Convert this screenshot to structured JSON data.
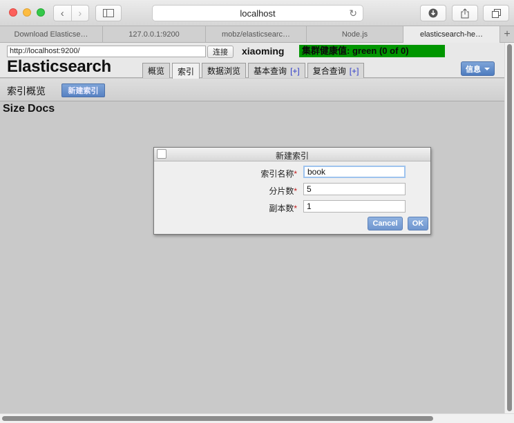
{
  "browser": {
    "url": "localhost",
    "tabs": [
      {
        "label": "Download Elasticse…",
        "active": false
      },
      {
        "label": "127.0.0.1:9200",
        "active": false
      },
      {
        "label": "mobz/elasticsearc…",
        "active": false
      },
      {
        "label": "Node.js",
        "active": false
      },
      {
        "label": "elasticsearch-he…",
        "active": true
      }
    ],
    "new_tab_label": "+"
  },
  "header": {
    "cluster_url": "http://localhost:9200/",
    "connect_label": "连接",
    "cluster_name": "xiaoming",
    "health": "集群健康值: green (0 of 0)",
    "brand": "Elasticsearch",
    "tabs": [
      {
        "label": "概览",
        "plus": ""
      },
      {
        "label": "索引",
        "plus": ""
      },
      {
        "label": "数据浏览",
        "plus": ""
      },
      {
        "label": "基本查询",
        "plus": "[+]"
      },
      {
        "label": "复合查询",
        "plus": "[+]"
      }
    ],
    "info_label": "信息"
  },
  "subbar": {
    "title": "索引概览",
    "new_index_label": "新建索引"
  },
  "columns": {
    "size": "Size",
    "docs": "Docs"
  },
  "dialog": {
    "title": "新建索引",
    "fields": [
      {
        "label": "索引名称",
        "required": "*",
        "value": "book"
      },
      {
        "label": "分片数",
        "required": "*",
        "value": "5"
      },
      {
        "label": "副本数",
        "required": "*",
        "value": "1"
      }
    ],
    "cancel_label": "Cancel",
    "ok_label": "OK"
  },
  "colors": {
    "health_green": "#009600",
    "button_blue": "#5781c2",
    "required_red": "#c21a1a"
  }
}
